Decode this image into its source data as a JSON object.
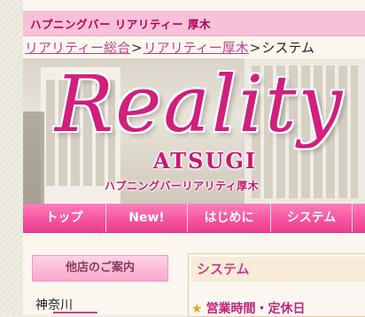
{
  "header": {
    "site_title": "ハプニングバー リアリティー 厚木"
  },
  "breadcrumb": {
    "items": [
      {
        "label": "リアリティー総合",
        "link": true
      },
      {
        "label": "リアリティー厚木",
        "link": true
      },
      {
        "label": "システム",
        "link": false
      }
    ],
    "separator": ">"
  },
  "banner": {
    "logo_text": "Reality",
    "logo_subtitle": "ATSUGI",
    "tagline": "ハプニングバーリアリティ厚木"
  },
  "nav": {
    "items": [
      {
        "label": "トップ"
      },
      {
        "label": "New!"
      },
      {
        "label": "はじめに"
      },
      {
        "label": "システム"
      }
    ]
  },
  "sidebar": {
    "heading": "他店のご案内",
    "region": "神奈川"
  },
  "main": {
    "section_title": "システム",
    "hours_heading": "営業時間・定休日",
    "star_icon": "star-icon"
  },
  "colors": {
    "accent": "#d01f7c",
    "nav": "#f5559f",
    "topbar": "#f7c1d8"
  }
}
